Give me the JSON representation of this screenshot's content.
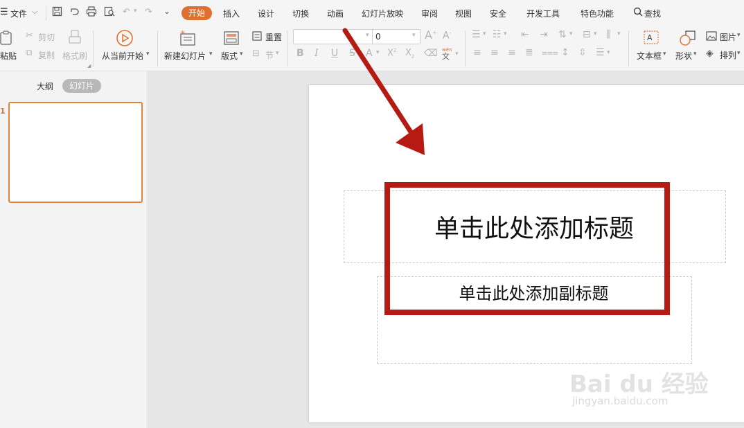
{
  "menubar": {
    "file_icon": "hamburger-icon",
    "file_label": "文件",
    "tabs": [
      "开始",
      "插入",
      "设计",
      "切换",
      "动画",
      "幻灯片放映",
      "审阅",
      "视图",
      "安全",
      "开发工具",
      "特色功能"
    ],
    "search_label": "查找"
  },
  "ribbon": {
    "paste_label": "粘贴",
    "cut_label": "剪切",
    "copy_label": "复制",
    "format_painter_label": "格式刷",
    "from_current_label": "从当前开始",
    "new_slide_label": "新建幻灯片",
    "layout_label": "版式",
    "reset_label": "重置",
    "section_label": "节",
    "font_name": "",
    "font_size": "0",
    "textbox_label": "文本框",
    "shape_label": "形状",
    "picture_label": "图片",
    "arrange_label": "排列"
  },
  "panel": {
    "tab_outline": "大纲",
    "tab_slides": "幻灯片",
    "slide_number": "1"
  },
  "slide": {
    "title_placeholder": "单击此处添加标题",
    "subtitle_placeholder": "单击此处添加副标题"
  },
  "watermark": {
    "brand": "Bai du 经验",
    "url": "jingyan.baidu.com"
  },
  "colors": {
    "accent": "#e0702f",
    "annotation_red": "#b51b13"
  }
}
